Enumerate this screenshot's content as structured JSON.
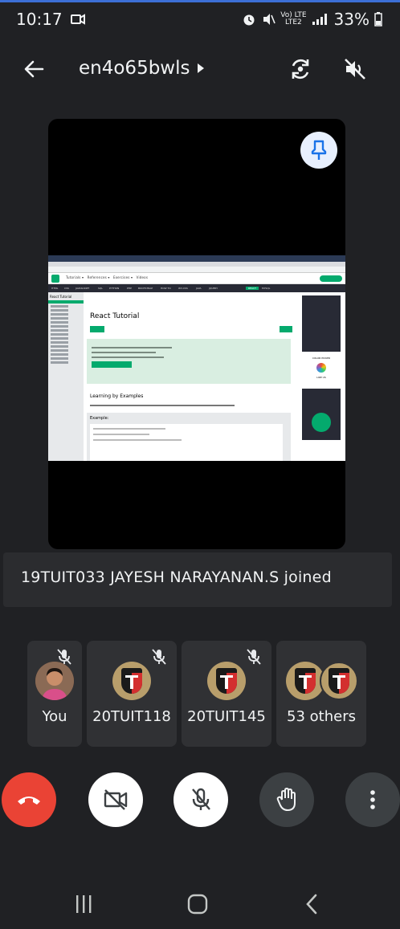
{
  "status_bar": {
    "time": "10:17",
    "carrier_top": "Vo) LTE",
    "carrier_bottom": "LTE2",
    "battery": "33%"
  },
  "header": {
    "meeting_code": "en4o65bwls"
  },
  "shared_screen": {
    "page_heading": "React Tutorial",
    "section_heading": "Learning by Examples",
    "example_label": "Example:",
    "sidebar_title": "React Tutorial",
    "color_picker_label": "COLOR PICKER",
    "like_us_label": "LIKE US"
  },
  "notification": {
    "text": "19TUIT033 JAYESH NARAYANAN.S joined"
  },
  "participants": [
    {
      "label": "You",
      "avatar": "self-photo",
      "muted": true
    },
    {
      "label": "20TUIT118",
      "avatar": "college-crest",
      "muted": true
    },
    {
      "label": "20TUIT145",
      "avatar": "college-crest",
      "muted": true
    },
    {
      "label": "53 others",
      "avatar": "college-crest-group",
      "muted": false
    }
  ],
  "controls": {
    "end_call": "end-call-icon",
    "camera": "camera-off-icon",
    "microphone": "mic-off-icon",
    "raise_hand": "hand-icon",
    "more": "more-vert-icon"
  },
  "colors": {
    "background": "#202124",
    "end_call": "#ea4335",
    "tile": "#303134",
    "pin_accent": "#1a73e8",
    "w3_green": "#04aa6d"
  }
}
